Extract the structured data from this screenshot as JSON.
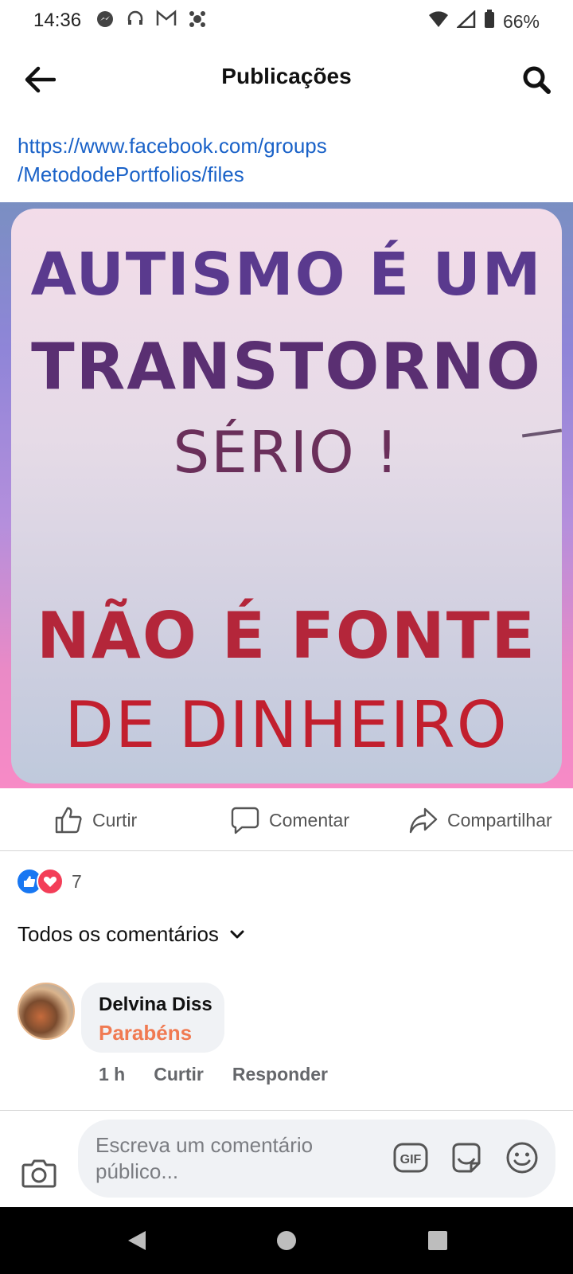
{
  "status": {
    "time": "14:36",
    "battery": "66%",
    "left_icons": [
      "messenger-icon",
      "headset-icon",
      "gmail-icon",
      "app-icon"
    ],
    "right_icons": [
      "wifi-icon",
      "signal-icon",
      "battery-icon"
    ]
  },
  "header": {
    "title": "Publicações"
  },
  "post": {
    "link_line1": "https://www.facebook.com/groups",
    "link_line2": "/MetododePortfolios/files",
    "image_text": {
      "line1": "AUTISMO É UM",
      "line2": "TRANSTORNO",
      "line3": "SÉRIO !",
      "line4": "NÃO É FONTE",
      "line5": "DE DINHEIRO"
    }
  },
  "actions": {
    "like": "Curtir",
    "comment": "Comentar",
    "share": "Compartilhar"
  },
  "reactions": {
    "count": "7",
    "types": [
      "like",
      "love"
    ],
    "like_color": "#1877f2",
    "love_color": "#f33e58"
  },
  "comments": {
    "filter_label": "Todos os comentários",
    "items": [
      {
        "author": "Delvina Diss",
        "text": "Parabéns",
        "time": "1 h",
        "like_label": "Curtir",
        "reply_label": "Responder"
      }
    ]
  },
  "composer": {
    "placeholder": "Escreva um comentário público...",
    "gif_label": "GIF"
  },
  "colors": {
    "accent": "#1a62c8",
    "comment_text": "#f07a52"
  }
}
